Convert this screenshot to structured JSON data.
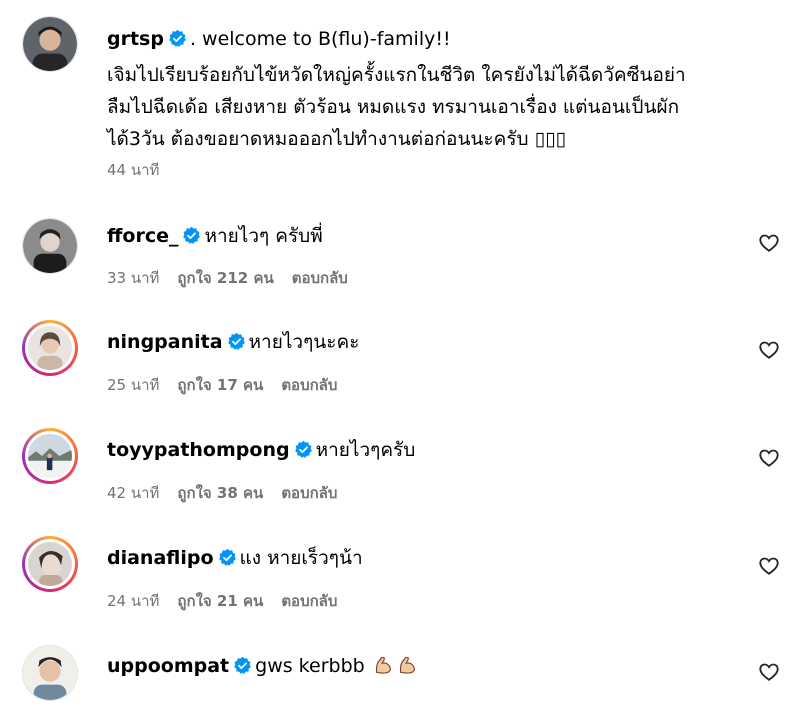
{
  "caption": {
    "username": "grtsp",
    "first_line": ". welcome to B(flu)-family!!",
    "body_line_1": "เจิมไปเรียบร้อยกับไข้หวัดใหญ่ครั้งแรกในชีวิต ใครยังไม่ได้ฉีดวัคซีนอย่า",
    "body_line_2": "ลืมไปฉีดเด้อ เสียงหาย ตัวร้อน หมดแรง ทรมานเอาเรื่อง แต่นอนเป็นผัก",
    "body_line_3": "ได้3วัน ต้องขอยาดหมอออกไปทำงานต่อก่อนนะครับ ▯▯▯",
    "time": "44 นาที"
  },
  "comments": [
    {
      "username": "fforce_",
      "text": "หายไวๆ ครับพี่",
      "time": "33 นาที",
      "likes": "ถูกใจ 212 คน",
      "reply": "ตอบกลับ"
    },
    {
      "username": "ningpanita",
      "text": "หายไวๆนะคะ",
      "time": "25 นาที",
      "likes": "ถูกใจ 17 คน",
      "reply": "ตอบกลับ"
    },
    {
      "username": "toyypathompong",
      "text": "หายไวๆครับ",
      "time": "42 นาที",
      "likes": "ถูกใจ 38 คน",
      "reply": "ตอบกลับ"
    },
    {
      "username": "dianaflipo",
      "text": "แง หายเร็วๆน้า",
      "time": "24 นาที",
      "likes": "ถูกใจ 21 คน",
      "reply": "ตอบกลับ"
    },
    {
      "username": "uppoompat",
      "text": "gws kerbbb",
      "time": "",
      "likes": "",
      "reply": ""
    }
  ],
  "colors": {
    "verified": "#0095f6",
    "meta": "#737373"
  },
  "icons": {
    "verified": "verified-badge-icon",
    "like": "heart-icon",
    "emoji": "flexed-biceps-emoji"
  }
}
